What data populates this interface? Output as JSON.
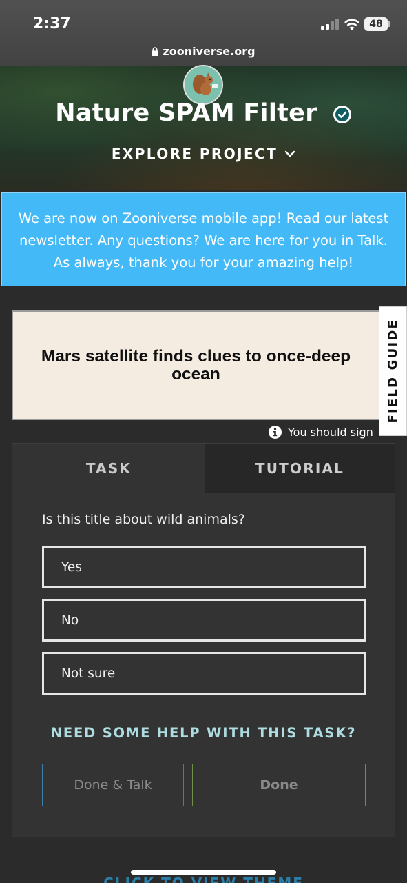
{
  "status_bar": {
    "time": "2:37",
    "battery": "48",
    "url": "zooniverse.org"
  },
  "project": {
    "title": "Nature SPAM Filter",
    "explore_label": "EXPLORE PROJECT",
    "verified": true
  },
  "announcement": {
    "part1": "We are now on Zooniverse mobile app! ",
    "read_link": "Read",
    "part2": " our latest newsletter. Any questions? We are here for you in ",
    "talk_link": "Talk",
    "part3": ". As always, thank you for your amazing help!"
  },
  "subject": {
    "title": "Mars satellite finds clues to once-deep ocean"
  },
  "field_guide_label": "FIELD GUIDE",
  "signin_note": "You should sign",
  "tabs": {
    "task": "TASK",
    "tutorial": "TUTORIAL"
  },
  "task": {
    "question": "Is this title about wild animals?",
    "answers": [
      "Yes",
      "No",
      "Not sure"
    ],
    "help_label": "NEED SOME HELP WITH THIS TASK?",
    "done_talk_label": "Done & Talk",
    "done_label": "Done"
  },
  "bottom_cut_text": "CLICK TO VIEW THEME",
  "colors": {
    "banner": "#43b9f7",
    "panel": "#333333",
    "help_text": "#addde0",
    "done_talk_border": "#3d7fa8",
    "done_border": "#6f8f4a"
  }
}
